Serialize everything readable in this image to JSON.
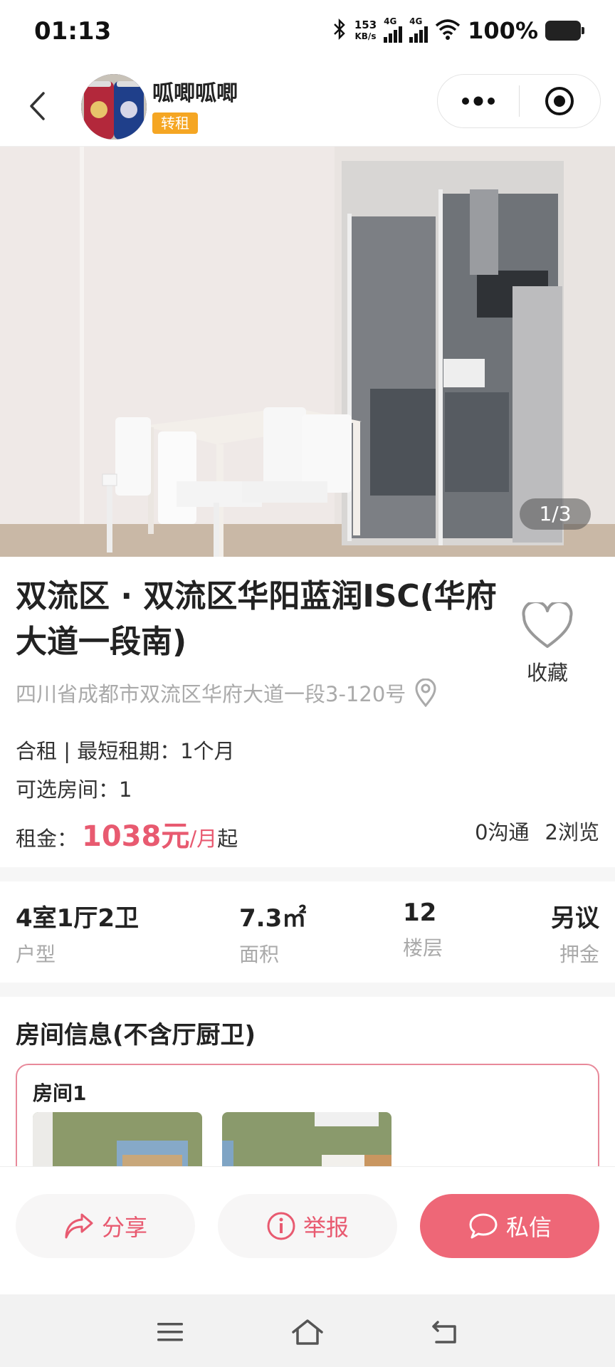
{
  "status_bar": {
    "time": "01:13",
    "net_speed_value": "153",
    "net_speed_unit": "KB/s",
    "sim1_tag": "4G",
    "sim2_tag": "4G",
    "battery": "100%"
  },
  "header": {
    "user_name": "呱唧呱唧",
    "user_tag": "转租"
  },
  "photo": {
    "counter": "1/3"
  },
  "listing": {
    "title": "双流区 · 双流区华阳蓝润ISC(华府大道一段南)",
    "address": "四川省成都市双流区华府大道一段3-120号",
    "favorite_label": "收藏",
    "rent_type": "合租 | 最短租期：1个月",
    "rooms_available": "可选房间：1",
    "rent_label": "租金：",
    "rent_price": "1038元",
    "rent_unit": "/月",
    "rent_suffix": "起",
    "contacts": "0沟通",
    "views": "2浏览"
  },
  "specs": [
    {
      "value": "4室1厅2卫",
      "label": "户型"
    },
    {
      "value": "7.3㎡",
      "label": "面积"
    },
    {
      "value": "12",
      "label": "楼层"
    },
    {
      "value": "另议",
      "label": "押金"
    }
  ],
  "room_section": {
    "title": "房间信息(不含厅厨卫)",
    "card_title": "房间1"
  },
  "actions": {
    "share": "分享",
    "report": "举报",
    "message": "私信"
  },
  "colors": {
    "accent": "#ee6777",
    "price": "#e85a70",
    "tag": "#f5a623"
  },
  "icons": [
    "back-icon",
    "more-icon",
    "close-target-icon",
    "heart-icon",
    "location-pin-icon",
    "share-icon",
    "info-icon",
    "chat-icon",
    "menu-icon",
    "home-icon",
    "back-nav-icon"
  ]
}
